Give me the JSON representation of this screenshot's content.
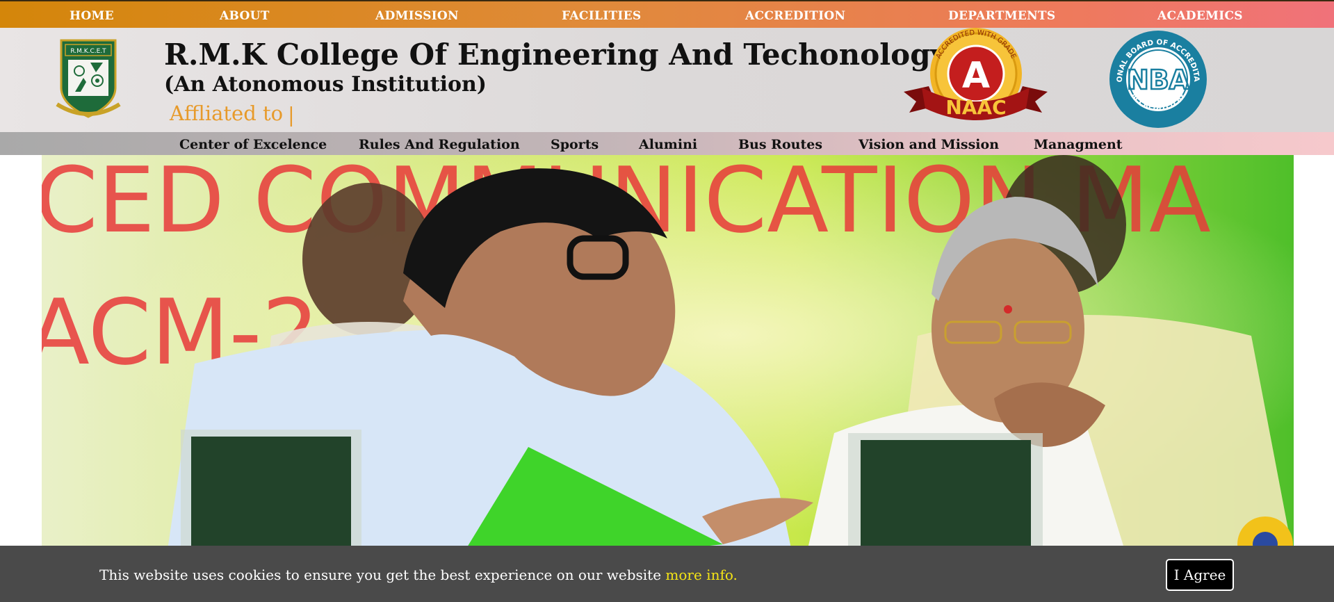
{
  "topnav": {
    "items": [
      "HOME",
      "ABOUT",
      "ADMISSION",
      "FACILITIES",
      "ACCREDITION",
      "DEPARTMENTS",
      "ACADEMICS"
    ]
  },
  "header": {
    "title": "R.M.K College Of Engineering And Techonology",
    "subtitle": "(An Atonomous Institution)",
    "affiliated": "Affliated to",
    "cursor": "|",
    "logo_text": "R.M.K.C.E.T",
    "naac_ring_text": "ACCREDITED WITH GRADE",
    "naac_grade": "A",
    "naac_ribbon": "NAAC",
    "nba_ring_text": "NATIONAL BOARD OF ACCREDITATION",
    "nba_bottom_text": "ACCREDITED BY",
    "nba_text": "NBA"
  },
  "subnav": {
    "items": [
      "Center of Excelence",
      "Rules And Regulation",
      "Sports",
      "Alumini",
      "Bus Routes",
      "Vision and Mission",
      "Managment"
    ]
  },
  "hero": {
    "banner_text_line1": "CED COMMUNICATION   MA",
    "banner_text_line2": "ACM-2"
  },
  "cookie": {
    "message": "This website uses cookies to ensure you get the best experience on our website",
    "more_info": "more info.",
    "agree_label": "I Agree"
  },
  "colors": {
    "nav_gradient_start": "#d4860a",
    "nav_gradient_end": "#f0727a",
    "header_bg": "#e0dddd",
    "accent_orange": "#e79a2a",
    "cookie_bg": "#4a4a4a",
    "cookie_link": "#f4e416",
    "nba_blue": "#1a7fa0",
    "naac_red": "#b01818",
    "logo_green": "#1e6b3a"
  }
}
